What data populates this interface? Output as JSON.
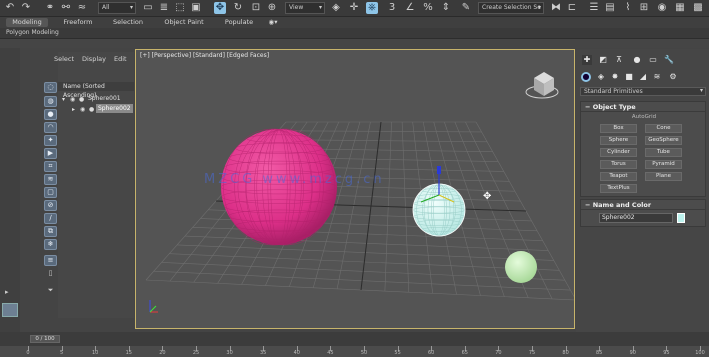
{
  "toolbar": {
    "selection_filter": "All",
    "view_coord": "View",
    "selection_set": "Create Selection Se"
  },
  "ribbon": {
    "tabs": [
      "Modeling",
      "Freeform",
      "Selection",
      "Object Paint",
      "Populate"
    ],
    "active_tab": "Modeling",
    "subtab": "Polygon Modeling"
  },
  "explorer": {
    "menu": [
      "Select",
      "Display",
      "Edit"
    ],
    "header": "Name (Sorted Ascending)",
    "items": [
      {
        "name": "Sphere001",
        "selected": false
      },
      {
        "name": "Sphere002",
        "selected": true
      }
    ]
  },
  "viewport": {
    "label": "[+] [Perspective] [Standard] [Edged Faces]",
    "watermark": "MZCG  www.mzcg.cn"
  },
  "command_panel": {
    "dropdown": "Standard Primitives",
    "object_type": {
      "title": "Object Type",
      "autogrid": "AutoGrid",
      "buttons": [
        "Box",
        "Cone",
        "Sphere",
        "GeoSphere",
        "Cylinder",
        "Tube",
        "Torus",
        "Pyramid",
        "Teapot",
        "Plane",
        "TextPlus"
      ]
    },
    "name_color": {
      "title": "Name and Color",
      "name_value": "Sphere002",
      "color": "#bdf3ee"
    }
  },
  "timeline": {
    "frame": "0 / 100",
    "ticks": [
      "0",
      "5",
      "10",
      "15",
      "20",
      "25",
      "30",
      "35",
      "40",
      "45",
      "50",
      "55",
      "60",
      "65",
      "70",
      "75",
      "80",
      "85",
      "90",
      "95",
      "100"
    ]
  },
  "colors": {
    "sphere001": "#e0378f",
    "sphere002": "#d9f7f4",
    "small_sphere": "#c8f0b8",
    "viewport_border": "#c7b46b",
    "accent": "#8ec5e8"
  }
}
